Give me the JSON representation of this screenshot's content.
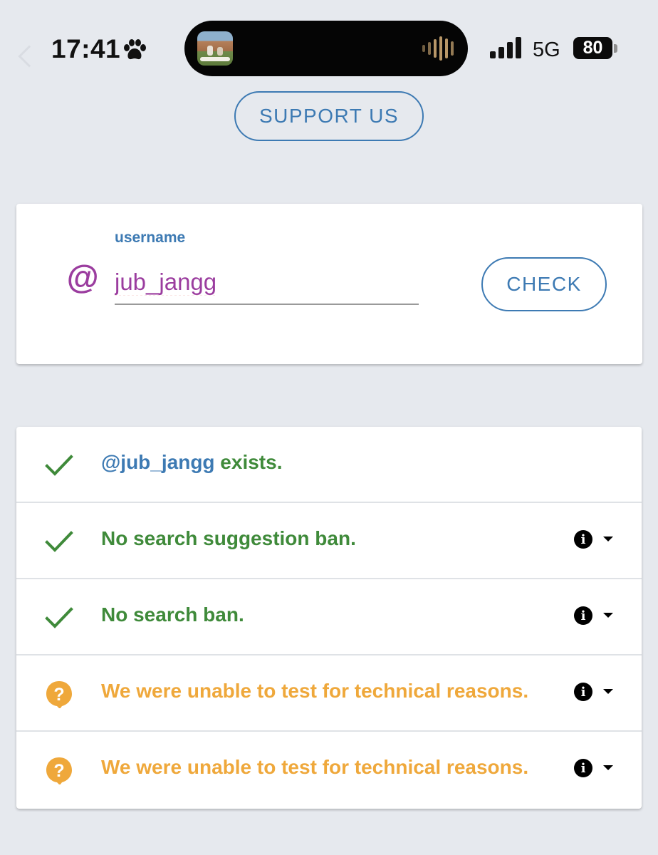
{
  "status_bar": {
    "time": "17:41",
    "network": "5G",
    "battery": "80"
  },
  "header": {
    "support_label": "SUPPORT US"
  },
  "search": {
    "field_label": "username",
    "at_symbol": "@",
    "value": "jub_jangg",
    "check_label": "CHECK"
  },
  "results": [
    {
      "status": "ok",
      "prefix": "@jub_jangg",
      "text": " exists.",
      "has_details": false
    },
    {
      "status": "ok",
      "prefix": "",
      "text": "No search suggestion ban.",
      "has_details": true
    },
    {
      "status": "ok",
      "prefix": "",
      "text": "No search ban.",
      "has_details": true
    },
    {
      "status": "unknown",
      "prefix": "",
      "text": "We were unable to test for technical reasons.",
      "has_details": true
    },
    {
      "status": "unknown",
      "prefix": "",
      "text": "We were unable to test for technical reasons.",
      "has_details": true
    }
  ],
  "colors": {
    "accent_blue": "#3d7ab3",
    "success_green": "#3f8a3a",
    "warning_orange": "#efa83b",
    "at_purple": "#9b3d9f",
    "background": "#e6e9ee"
  },
  "icons": {
    "ok": "check-icon",
    "unknown": "question-bubble-icon",
    "details": "info-icon",
    "expand": "caret-down-icon"
  }
}
